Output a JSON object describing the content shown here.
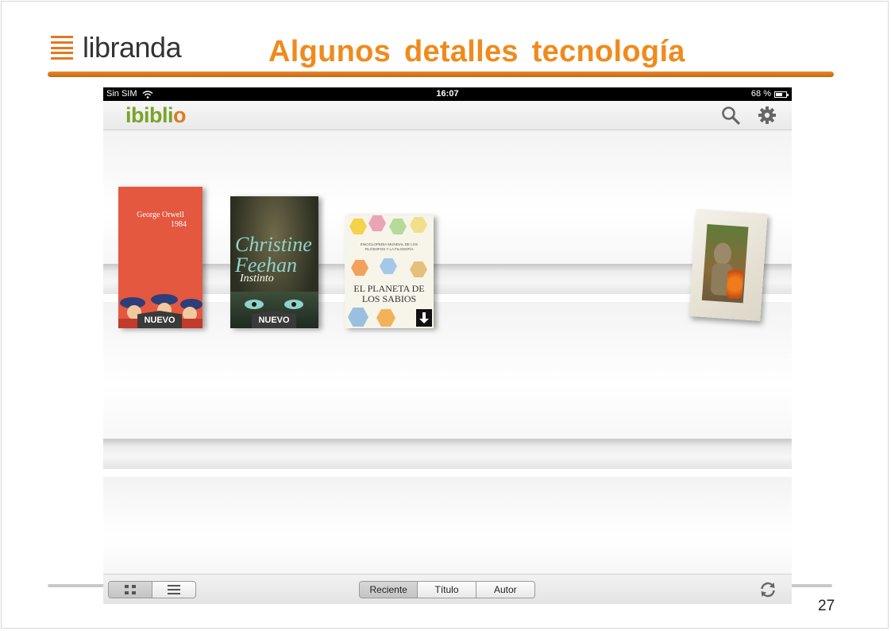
{
  "slide": {
    "logo_text": "libranda",
    "title": "Algunos detalles tecnología",
    "page_number": "27",
    "accent_color": "#f08a1c"
  },
  "device": {
    "status": {
      "carrier": "Sin SIM",
      "time": "16:07",
      "battery_text": "68 %",
      "battery_level": 0.68
    },
    "app": {
      "logo_main": "ibibli",
      "logo_end": "o",
      "logo_color": "#7aa32a",
      "icons": [
        "search-icon",
        "gear-icon"
      ]
    },
    "shelf": {
      "books": [
        {
          "author": "George Orwell",
          "title": "1984",
          "badge": "NUEVO",
          "cover_color": "#e4583f"
        },
        {
          "author": "Christine Feehan",
          "title": "Instinto",
          "badge": "NUEVO"
        },
        {
          "subtitle": "ENCICLOPEDIA MUNDIAL DE LOS FILÓSOFOS Y LA FILOSOFÍA",
          "title": "EL PLANETA DE LOS SABIOS",
          "action_icon": "download-icon"
        }
      ]
    },
    "toolbar": {
      "view_modes": [
        "grid-view-icon",
        "list-view-icon"
      ],
      "sort_options": [
        "Reciente",
        "Título",
        "Autor"
      ],
      "sort_selected": "Reciente",
      "sync_icon": "sync-icon"
    }
  }
}
